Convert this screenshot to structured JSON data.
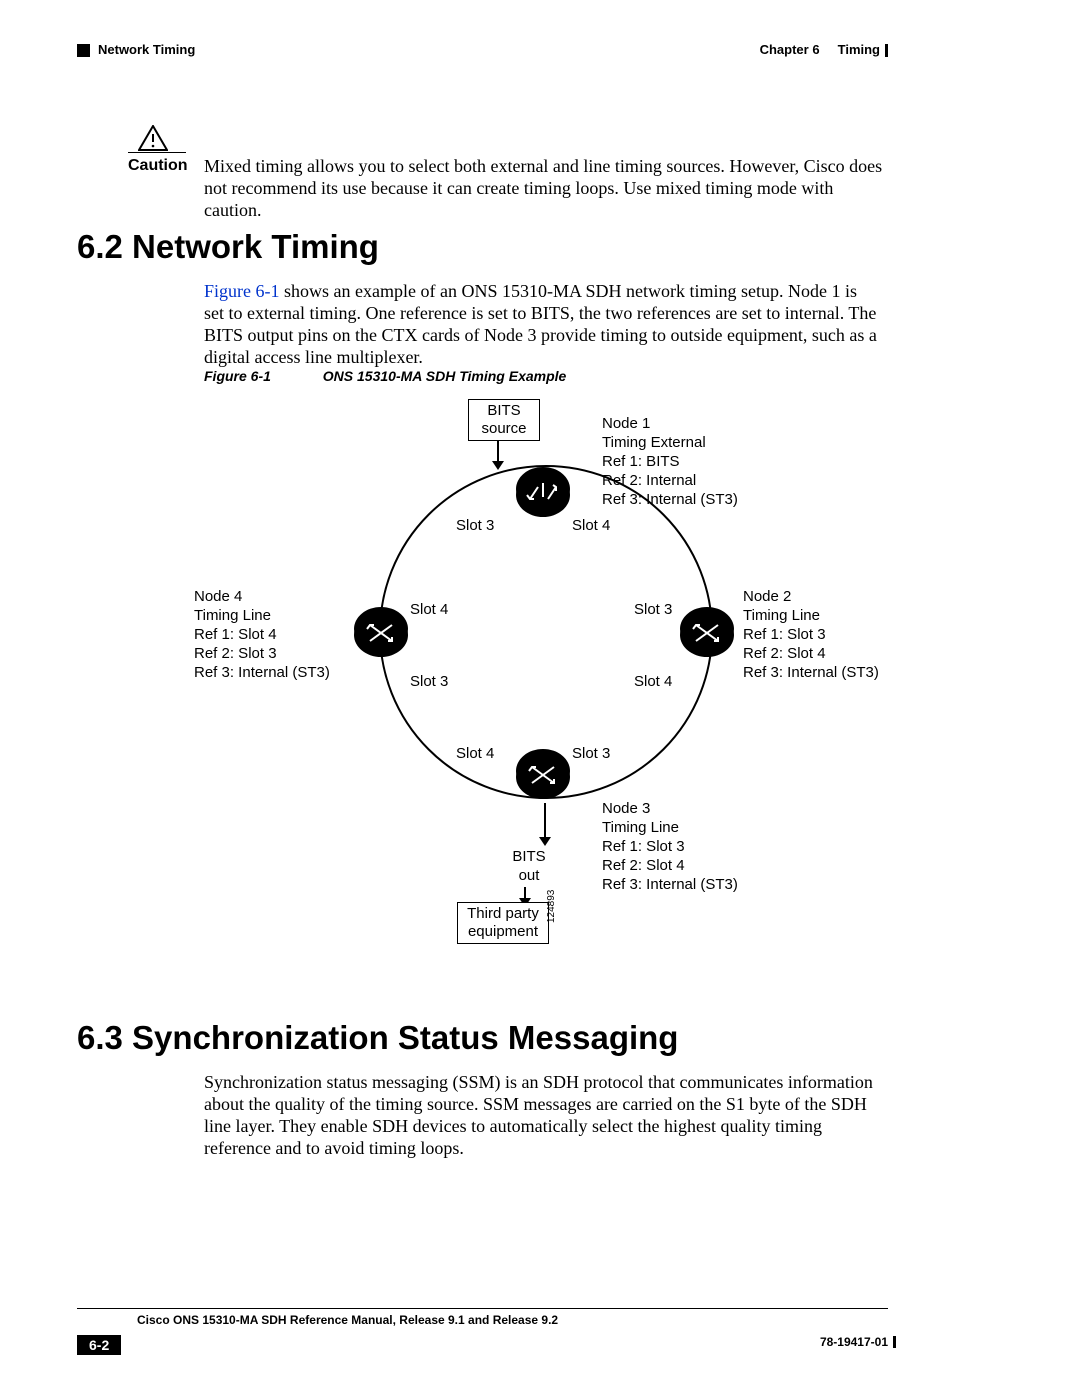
{
  "header": {
    "chapter": "Chapter 6",
    "chapter_title": "Timing",
    "section_left": "Network Timing"
  },
  "caution": {
    "label": "Caution",
    "body": "Mixed timing allows you to select both external and line timing sources. However, Cisco does not recommend its use because it can create timing loops. Use mixed timing mode with caution."
  },
  "section62": {
    "heading": "6.2  Network Timing",
    "figref": "Figure 6-1",
    "body_after_ref": " shows an example of an ONS 15310-MA SDH network timing setup. Node 1 is set to external timing. One reference is set to BITS, the two references are set to internal. The BITS output pins on the CTX cards of Node 3 provide timing to outside equipment, such as a digital access line multiplexer."
  },
  "figure": {
    "label": "Figure 6-1",
    "title": "ONS 15310-MA SDH Timing Example",
    "bits_source": "BITS\nsource",
    "bits_out": "BITS\nout",
    "third_party": "Third party\nequipment",
    "code": "124893",
    "slots": {
      "top_left": "Slot 3",
      "top_right": "Slot 4",
      "right_top": "Slot 3",
      "right_bottom": "Slot 4",
      "bottom_left": "Slot 4",
      "bottom_right": "Slot 3",
      "left_top": "Slot 4",
      "left_bottom": "Slot 3"
    },
    "node1": "Node 1\nTiming External\nRef 1: BITS\nRef 2: Internal\nRef 3: Internal (ST3)",
    "node2": "Node 2\nTiming Line\nRef 1: Slot 3\nRef 2: Slot 4\nRef 3: Internal (ST3)",
    "node3": "Node 3\nTiming Line\nRef 1: Slot 3\nRef 2: Slot 4\nRef 3: Internal (ST3)",
    "node4": "Node 4\nTiming Line\nRef 1: Slot 4\nRef 2: Slot 3\nRef 3: Internal (ST3)"
  },
  "section63": {
    "heading": "6.3  Synchronization Status Messaging",
    "body": "Synchronization status messaging (SSM) is an SDH protocol that communicates information about the quality of the timing source. SSM messages are carried on the S1 byte of the SDH line layer. They enable SDH devices to automatically select the highest quality timing reference and to avoid timing loops."
  },
  "footer": {
    "manual": "Cisco ONS 15310-MA SDH Reference Manual, Release 9.1 and Release 9.2",
    "page": "6-2",
    "docnum": "78-19417-01"
  }
}
